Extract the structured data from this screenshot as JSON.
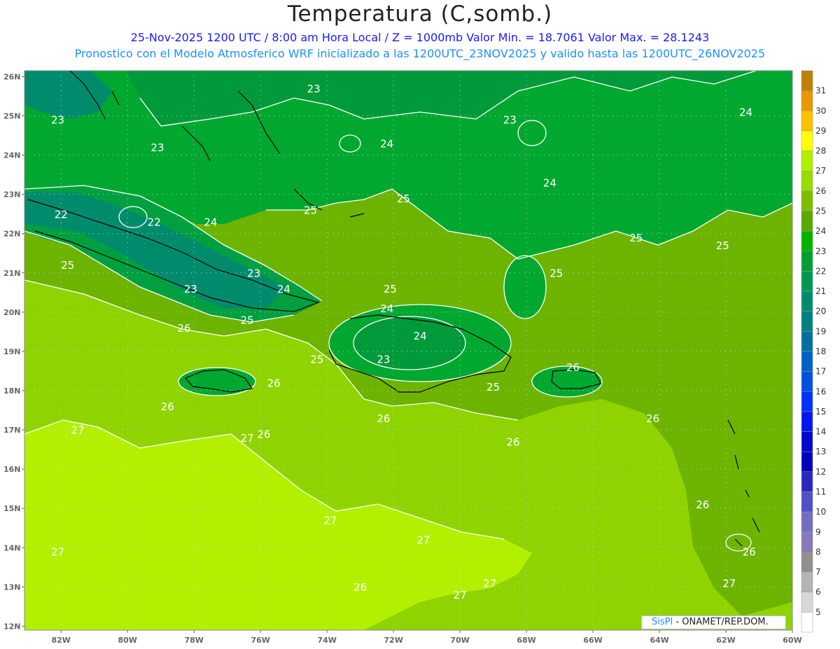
{
  "header": {
    "title": "Temperatura (C,somb.)",
    "line1": "25-Nov-2025  1200 UTC / 8:00 am Hora Local / Z = 1000mb   Valor Min. = 18.7061  Valor Max. = 28.1243",
    "line2": "Pronostico con el Modelo Atmosferico WRF inicializado a las 1200UTC_23NOV2025 y valido hasta las  1200UTC_26NOV2025"
  },
  "map": {
    "lat_labels": [
      "26N",
      "25N",
      "24N",
      "23N",
      "22N",
      "21N",
      "20N",
      "19N",
      "18N",
      "17N",
      "16N",
      "15N",
      "14N",
      "13N",
      "12N"
    ],
    "lon_labels": [
      "82W",
      "80W",
      "78W",
      "76W",
      "74W",
      "72W",
      "70W",
      "68W",
      "66W",
      "64W",
      "62W",
      "60W"
    ],
    "contour_labels": [
      {
        "text": "23",
        "lon": -74.4,
        "lat": 25.6
      },
      {
        "text": "23",
        "lon": -82.1,
        "lat": 24.8
      },
      {
        "text": "23",
        "lon": -79.1,
        "lat": 24.1
      },
      {
        "text": "23",
        "lon": -68.5,
        "lat": 24.8
      },
      {
        "text": "24",
        "lon": -72.2,
        "lat": 24.2
      },
      {
        "text": "24",
        "lon": -61.4,
        "lat": 25.0
      },
      {
        "text": "24",
        "lon": -67.3,
        "lat": 23.2
      },
      {
        "text": "22",
        "lon": -82.0,
        "lat": 22.4
      },
      {
        "text": "22",
        "lon": -79.2,
        "lat": 22.2
      },
      {
        "text": "24",
        "lon": -77.5,
        "lat": 22.2
      },
      {
        "text": "25",
        "lon": -74.5,
        "lat": 22.5
      },
      {
        "text": "25",
        "lon": -71.7,
        "lat": 22.8
      },
      {
        "text": "25",
        "lon": -64.7,
        "lat": 21.8
      },
      {
        "text": "25",
        "lon": -62.1,
        "lat": 21.6
      },
      {
        "text": "25",
        "lon": -81.8,
        "lat": 21.1
      },
      {
        "text": "23",
        "lon": -76.2,
        "lat": 20.9
      },
      {
        "text": "24",
        "lon": -75.3,
        "lat": 20.5
      },
      {
        "text": "23",
        "lon": -78.1,
        "lat": 20.5
      },
      {
        "text": "25",
        "lon": -67.1,
        "lat": 20.9
      },
      {
        "text": "25",
        "lon": -72.1,
        "lat": 20.5
      },
      {
        "text": "24",
        "lon": -72.2,
        "lat": 20.0
      },
      {
        "text": "25",
        "lon": -76.4,
        "lat": 19.7
      },
      {
        "text": "26",
        "lon": -78.3,
        "lat": 19.5
      },
      {
        "text": "24",
        "lon": -71.2,
        "lat": 19.3
      },
      {
        "text": "25",
        "lon": -74.3,
        "lat": 18.7
      },
      {
        "text": "23",
        "lon": -72.3,
        "lat": 18.7
      },
      {
        "text": "26",
        "lon": -66.6,
        "lat": 18.5
      },
      {
        "text": "26",
        "lon": -75.6,
        "lat": 18.1
      },
      {
        "text": "25",
        "lon": -69.0,
        "lat": 18.0
      },
      {
        "text": "26",
        "lon": -78.8,
        "lat": 17.5
      },
      {
        "text": "26",
        "lon": -72.3,
        "lat": 17.2
      },
      {
        "text": "26",
        "lon": -64.2,
        "lat": 17.2
      },
      {
        "text": "27",
        "lon": -81.5,
        "lat": 16.9
      },
      {
        "text": "27",
        "lon": -76.4,
        "lat": 16.7
      },
      {
        "text": "26",
        "lon": -75.9,
        "lat": 16.8
      },
      {
        "text": "26",
        "lon": -68.4,
        "lat": 16.6
      },
      {
        "text": "26",
        "lon": -62.7,
        "lat": 15.0
      },
      {
        "text": "27",
        "lon": -73.9,
        "lat": 14.6
      },
      {
        "text": "27",
        "lon": -71.1,
        "lat": 14.1
      },
      {
        "text": "27",
        "lon": -82.1,
        "lat": 13.8
      },
      {
        "text": "26",
        "lon": -61.3,
        "lat": 13.8
      },
      {
        "text": "27",
        "lon": -69.1,
        "lat": 13.0
      },
      {
        "text": "26",
        "lon": -73.0,
        "lat": 12.9
      },
      {
        "text": "27",
        "lon": -70.0,
        "lat": 12.7
      },
      {
        "text": "27",
        "lon": -61.9,
        "lat": 13.0
      }
    ]
  },
  "colorbar": {
    "levels": [
      {
        "label": "31",
        "color": "#c08000"
      },
      {
        "label": "30",
        "color": "#e89800"
      },
      {
        "label": "29",
        "color": "#ffc000"
      },
      {
        "label": "28",
        "color": "#ffff00"
      },
      {
        "label": "27",
        "color": "#b0f000"
      },
      {
        "label": "26",
        "color": "#98dc00"
      },
      {
        "label": "25",
        "color": "#7cbf00"
      },
      {
        "label": "24",
        "color": "#5aa800"
      },
      {
        "label": "23",
        "color": "#00b400"
      },
      {
        "label": "22",
        "color": "#00a030"
      },
      {
        "label": "21",
        "color": "#009850"
      },
      {
        "label": "20",
        "color": "#008c6c"
      },
      {
        "label": "19",
        "color": "#008080"
      },
      {
        "label": "18",
        "color": "#0070a0"
      },
      {
        "label": "17",
        "color": "#0060c8"
      },
      {
        "label": "16",
        "color": "#0050e0"
      },
      {
        "label": "15",
        "color": "#0030ff"
      },
      {
        "label": "14",
        "color": "#0018f0"
      },
      {
        "label": "13",
        "color": "#0008d0"
      },
      {
        "label": "12",
        "color": "#0000b8"
      },
      {
        "label": "11",
        "color": "#2828c0"
      },
      {
        "label": "10",
        "color": "#5050c8"
      },
      {
        "label": "9",
        "color": "#7070c0"
      },
      {
        "label": "8",
        "color": "#8878b8"
      },
      {
        "label": "7",
        "color": "#909090"
      },
      {
        "label": "6",
        "color": "#b4b4b4"
      },
      {
        "label": "5",
        "color": "#d8d8d8"
      },
      {
        "label": "",
        "color": "#ffffff"
      }
    ]
  },
  "footer": {
    "brand": "SisPI",
    "credit": " ONAMET/REP.DOM."
  },
  "colors": {
    "green_dark": "#009a3a",
    "green": "#00a830",
    "green_mid": "#4aa300",
    "green_light": "#8fd400",
    "yellow_green": "#b2f000"
  }
}
